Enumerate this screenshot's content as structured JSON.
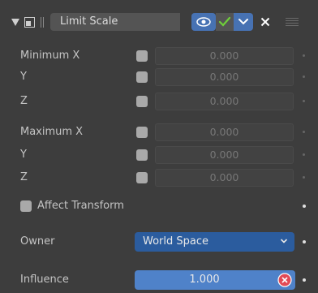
{
  "header": {
    "constraint_name": "Limit Scale"
  },
  "limits": [
    {
      "label": "Minimum X",
      "value": "0.000"
    },
    {
      "label": "Y",
      "value": "0.000"
    },
    {
      "label": "Z",
      "value": "0.000"
    },
    {
      "label": "Maximum X",
      "value": "0.000"
    },
    {
      "label": "Y",
      "value": "0.000"
    },
    {
      "label": "Z",
      "value": "0.000"
    }
  ],
  "affect_transform": {
    "label": "Affect Transform"
  },
  "owner": {
    "label": "Owner",
    "value": "World Space"
  },
  "influence": {
    "label": "Influence",
    "value": "1.000"
  },
  "colors": {
    "accent": "#4772b3",
    "check": "#6fcf3a",
    "remove": "#e24a55"
  }
}
